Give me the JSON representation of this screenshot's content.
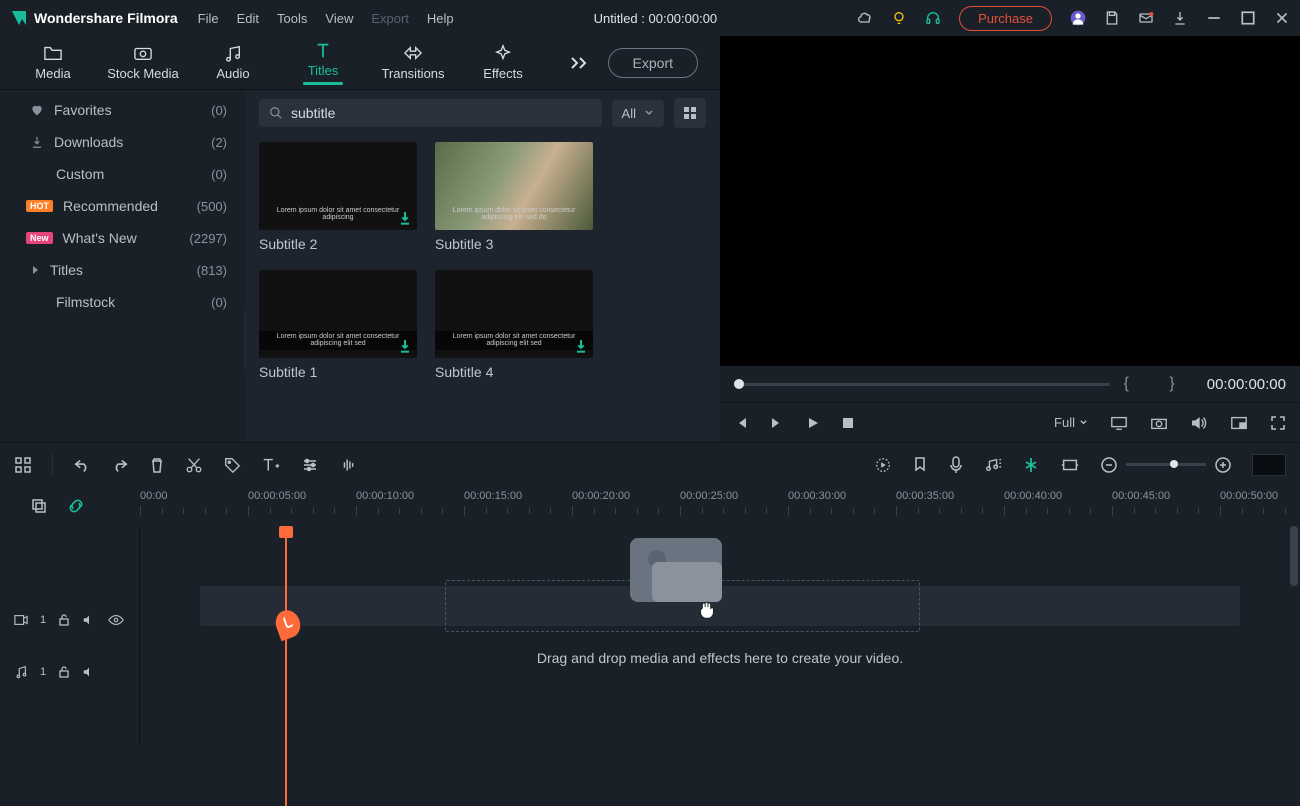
{
  "titlebar": {
    "app_name": "Wondershare Filmora",
    "menu": [
      "File",
      "Edit",
      "Tools",
      "View",
      "Export",
      "Help"
    ],
    "menu_disabled_index": 4,
    "project_title": "Untitled : 00:00:00:00",
    "purchase_label": "Purchase"
  },
  "tabs": {
    "items": [
      {
        "label": "Media",
        "icon": "folder"
      },
      {
        "label": "Stock Media",
        "icon": "stock"
      },
      {
        "label": "Audio",
        "icon": "audio"
      },
      {
        "label": "Titles",
        "icon": "titles"
      },
      {
        "label": "Transitions",
        "icon": "transitions"
      },
      {
        "label": "Effects",
        "icon": "effects"
      }
    ],
    "active_index": 3,
    "export_label": "Export"
  },
  "sidebar": {
    "items": [
      {
        "icon": "heart",
        "label": "Favorites",
        "count": "(0)"
      },
      {
        "icon": "download",
        "label": "Downloads",
        "count": "(2)"
      },
      {
        "icon": "",
        "label": "Custom",
        "count": "(0)",
        "sub": true
      },
      {
        "badge": "HOT",
        "badge_class": "hot",
        "label": "Recommended",
        "count": "(500)"
      },
      {
        "badge": "New",
        "badge_class": "new",
        "label": "What's New",
        "count": "(2297)"
      },
      {
        "icon": "caret",
        "label": "Titles",
        "count": "(813)"
      },
      {
        "icon": "",
        "label": "Filmstock",
        "count": "(0)",
        "sub": true
      }
    ]
  },
  "search": {
    "value": "subtitle",
    "filter_label": "All"
  },
  "thumbnails": [
    {
      "label": "Subtitle 2",
      "thumb": "dark",
      "caption": "lorem ipsum"
    },
    {
      "label": "Subtitle 3",
      "thumb": "image",
      "caption": "lorem ipsum dolor"
    },
    {
      "label": "Subtitle 1",
      "thumb": "dark",
      "caption": "lorem ipsum dolor sit"
    },
    {
      "label": "Subtitle 4",
      "thumb": "dark",
      "caption": "lorem ipsum dolor sit"
    }
  ],
  "preview": {
    "braces": "{  }",
    "timecode": "00:00:00:00",
    "quality_label": "Full"
  },
  "ruler": {
    "ticks": [
      "00:00",
      "00:00:05:00",
      "00:00:10:00",
      "00:00:15:00",
      "00:00:20:00",
      "00:00:25:00",
      "00:00:30:00",
      "00:00:35:00",
      "00:00:40:00",
      "00:00:45:00",
      "00:00:50:00"
    ]
  },
  "tracks": {
    "video_num": "1",
    "audio_num": "1",
    "drop_text": "Drag and drop media and effects here to create your video."
  }
}
